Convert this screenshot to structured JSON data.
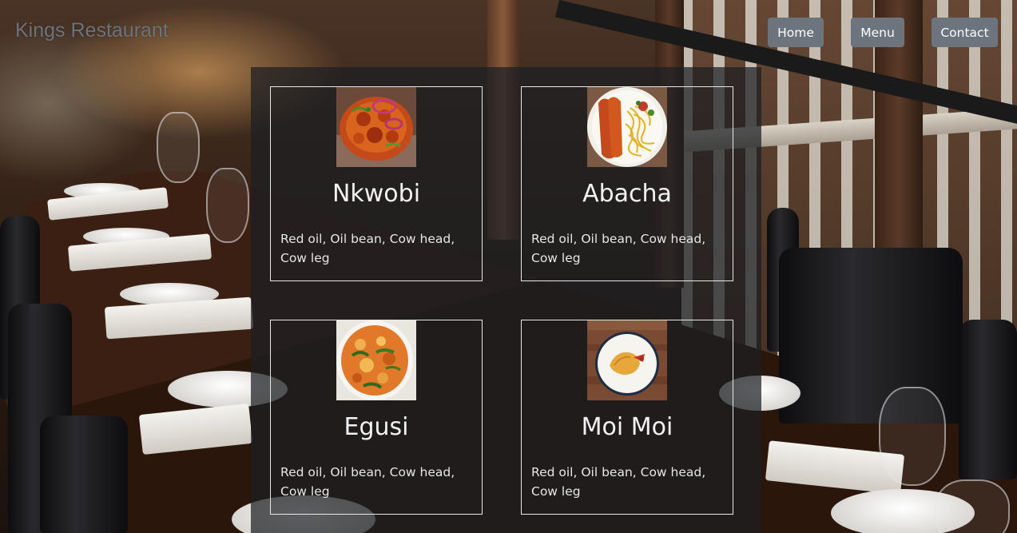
{
  "header": {
    "brand": "Kings Restaurant",
    "nav": [
      {
        "label": "Home"
      },
      {
        "label": "Menu"
      },
      {
        "label": "Contact"
      }
    ]
  },
  "menu": {
    "items": [
      {
        "name": "Nkwobi",
        "description": "Red oil, Oil bean, Cow head, Cow leg"
      },
      {
        "name": "Abacha",
        "description": "Red oil, Oil bean, Cow head, Cow leg"
      },
      {
        "name": "Egusi",
        "description": "Red oil, Oil bean, Cow head, Cow leg"
      },
      {
        "name": "Moi Moi",
        "description": "Red oil, Oil bean, Cow head, Cow leg"
      }
    ]
  },
  "colors": {
    "nav_button": "#6c757d",
    "brand_text": "#6b737d",
    "panel": "rgba(28,30,34,0.72)",
    "card_border": "#e8e8e8"
  }
}
